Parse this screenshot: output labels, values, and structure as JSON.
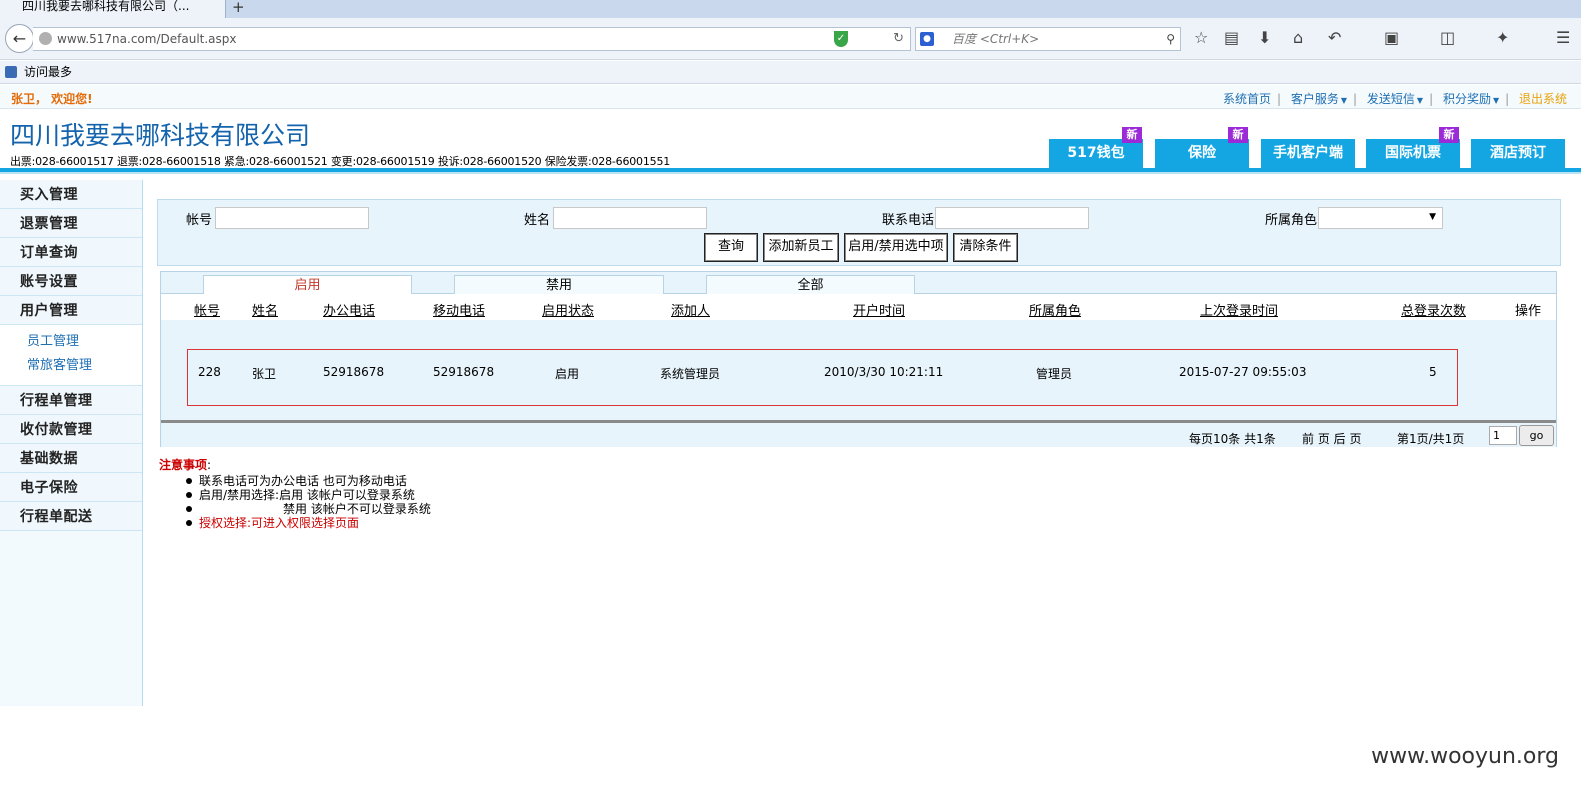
{
  "browser": {
    "tab_title": "四川我要去哪科技有限公司（...",
    "new_tab": "+",
    "url": "www.517na.com/Default.aspx",
    "search_placeholder": "百度 <Ctrl+K>",
    "bookmark": "访问最多"
  },
  "header": {
    "welcome": "张卫， 欢迎您!",
    "nav": [
      "系统首页",
      "客户服务",
      "发送短信",
      "积分奖励",
      "退出系统"
    ],
    "company": "四川我要去哪科技有限公司",
    "phones": "出票:028-66001517 退票:028-66001518 紧急:028-66001521 变更:028-66001519 投诉:028-66001520 保险发票:028-66001551",
    "product_tabs": [
      {
        "label": "517钱包",
        "badge": "新"
      },
      {
        "label": "保险",
        "badge": "新"
      },
      {
        "label": "手机客户端",
        "badge": ""
      },
      {
        "label": "国际机票",
        "badge": "新"
      },
      {
        "label": "酒店预订",
        "badge": ""
      }
    ]
  },
  "sidebar": {
    "items": [
      "买入管理",
      "退票管理",
      "订单查询",
      "账号设置",
      "用户管理"
    ],
    "subitems": [
      "员工管理",
      "常旅客管理"
    ],
    "items2": [
      "行程单管理",
      "收付款管理",
      "基础数据",
      "电子保险",
      "行程单配送"
    ]
  },
  "filter": {
    "account_label": "帐号",
    "name_label": "姓名",
    "phone_label": "联系电话",
    "role_label": "所属角色",
    "account_value": "",
    "name_value": "",
    "phone_value": "",
    "role_value": "",
    "buttons": [
      "查询",
      "添加新员工",
      "启用/禁用选中项",
      "清除条件"
    ]
  },
  "grid": {
    "tabs": [
      "启用",
      "禁用",
      "全部"
    ],
    "columns": [
      "帐号",
      "姓名",
      "办公电话",
      "移动电话",
      "启用状态",
      "添加人",
      "开户时间",
      "所属角色",
      "上次登录时间",
      "总登录次数",
      "操作"
    ],
    "rows": [
      [
        "228",
        "张卫",
        "52918678",
        "52918678",
        "启用",
        "系统管理员",
        "2010/3/30 10:21:11",
        "管理员",
        "2015-07-27 09:55:03",
        "5",
        ""
      ]
    ]
  },
  "pager": {
    "per_page": "每页10条 共1条",
    "nav": "前 页 后 页",
    "page_info": "第1页/共1页",
    "page_input": "1",
    "go": "go"
  },
  "notes": {
    "title": "注意事项",
    "colon": ":",
    "items": [
      "联系电话可为办公电话 也可为移动电话",
      "启用/禁用选择:启用 该帐户可以登录系统",
      "　　　　　　　禁用 该帐户不可以登录系统",
      "授权选择:可进入权限选择页面"
    ]
  },
  "watermark": "www.wooyun.org",
  "colors": {
    "accent": "#13a6e3",
    "brand": "#1363ad",
    "badge": "#9b2bd6",
    "warn": "#cc0000"
  }
}
